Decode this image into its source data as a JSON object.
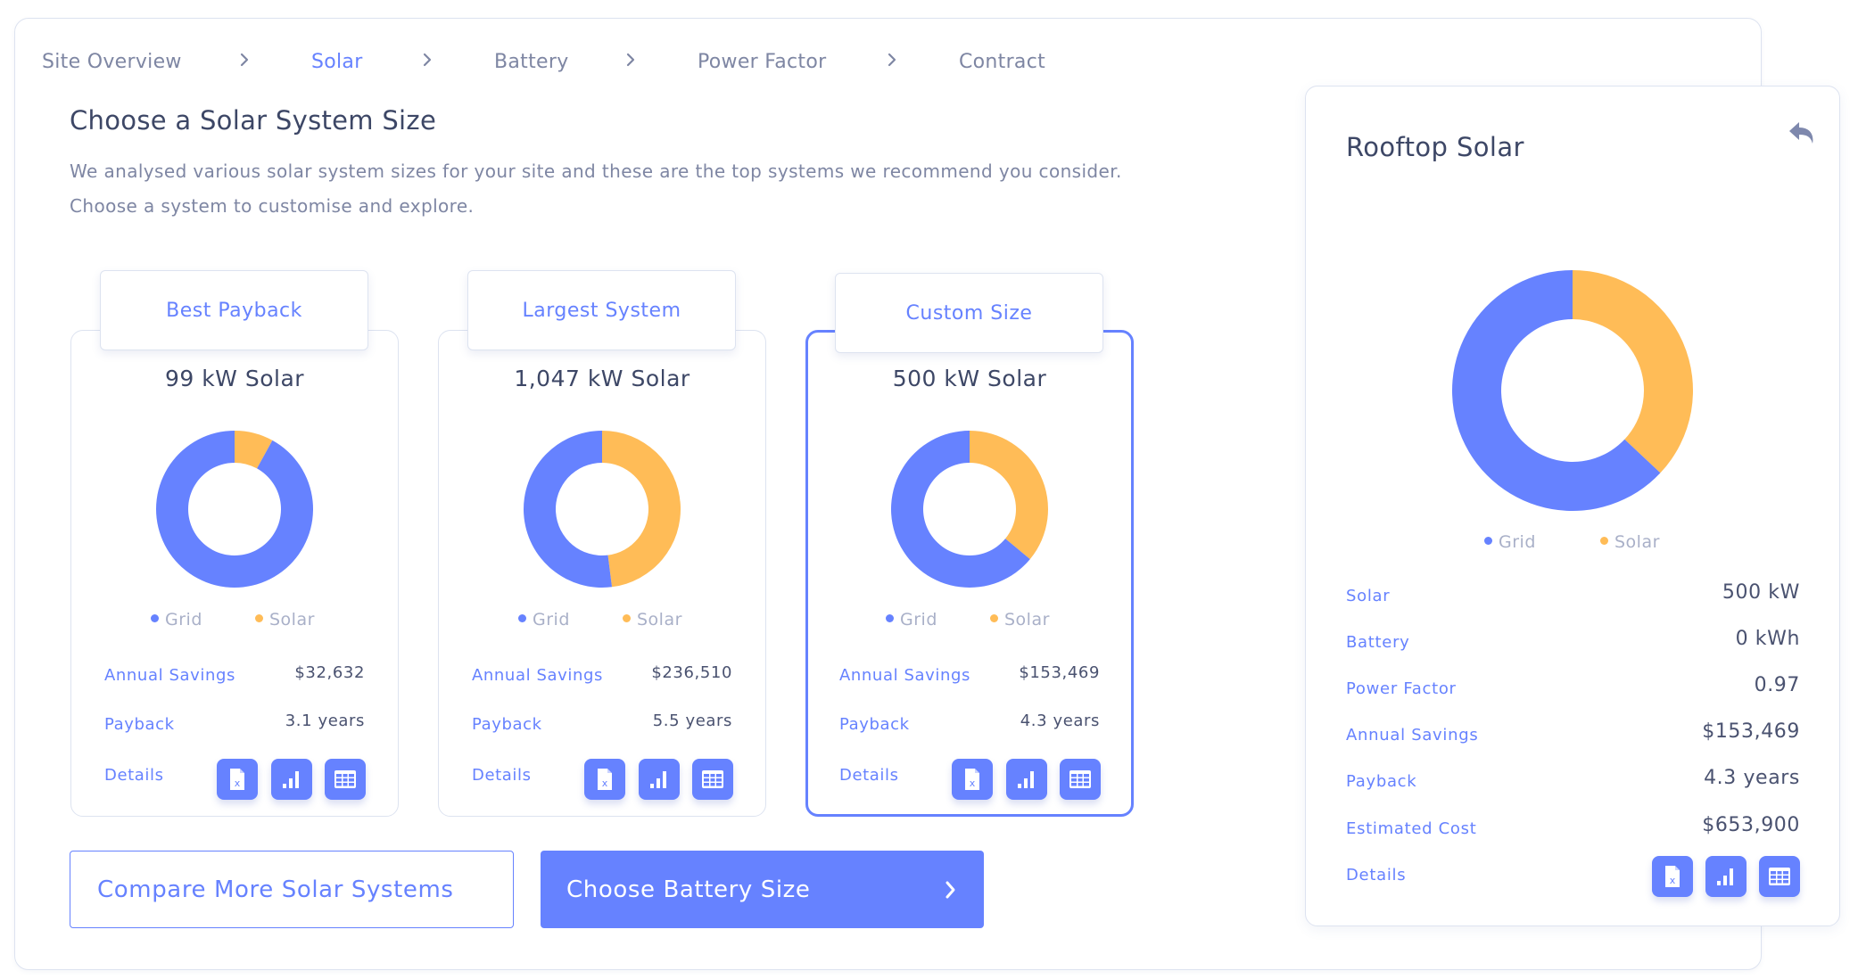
{
  "breadcrumb": {
    "items": [
      {
        "label": "Site Overview",
        "active": false
      },
      {
        "label": "Solar",
        "active": true
      },
      {
        "label": "Battery",
        "active": false
      },
      {
        "label": "Power Factor",
        "active": false
      },
      {
        "label": "Contract",
        "active": false
      }
    ],
    "separator_icon": "chevron-right-icon"
  },
  "header": {
    "title": "Choose a Solar System Size",
    "description_line1": "We analysed various solar system sizes for your site and these are the top systems we recommend you consider.",
    "description_line2": "Choose a system to customise and explore."
  },
  "colors": {
    "accent": "#6682ff",
    "grid": "#6682ff",
    "solar": "#ffbc57",
    "text_dark": "#3d4766",
    "text_muted": "#7e86a3",
    "border": "#dde3f0"
  },
  "legend": {
    "grid": "Grid",
    "solar": "Solar"
  },
  "cards": [
    {
      "tab_label": "Best Payback",
      "system_label": "99 kW Solar",
      "selected": false,
      "rows": {
        "annual_savings_label": "Annual Savings",
        "annual_savings": "$32,632",
        "payback_label": "Payback",
        "payback": "3.1 years",
        "details_label": "Details"
      }
    },
    {
      "tab_label": "Largest System",
      "system_label": "1,047 kW Solar",
      "selected": false,
      "rows": {
        "annual_savings_label": "Annual Savings",
        "annual_savings": "$236,510",
        "payback_label": "Payback",
        "payback": "5.5 years",
        "details_label": "Details"
      }
    },
    {
      "tab_label": "Custom Size",
      "system_label": "500 kW Solar",
      "selected": true,
      "rows": {
        "annual_savings_label": "Annual Savings",
        "annual_savings": "$153,469",
        "payback_label": "Payback",
        "payback": "4.3 years",
        "details_label": "Details"
      }
    }
  ],
  "detail_icons": [
    "excel-file-icon",
    "bar-chart-icon",
    "table-icon"
  ],
  "buttons": {
    "compare": "Compare More Solar Systems",
    "next": "Choose Battery Size"
  },
  "panel": {
    "title": "Rooftop Solar",
    "back_icon": "undo-icon",
    "rows": [
      {
        "label": "Solar",
        "value": "500 kW"
      },
      {
        "label": "Battery",
        "value": "0 kWh"
      },
      {
        "label": "Power Factor",
        "value": "0.97"
      },
      {
        "label": "Annual Savings",
        "value": "$153,469"
      },
      {
        "label": "Payback",
        "value": "4.3 years"
      },
      {
        "label": "Estimated Cost",
        "value": "$653,900"
      },
      {
        "label": "Details",
        "value": ""
      }
    ]
  },
  "chart_data": [
    {
      "type": "pie",
      "title": "99 kW Solar",
      "categories": [
        "Grid",
        "Solar"
      ],
      "values": [
        92,
        8
      ],
      "unit": "% of energy (est.)",
      "donut": true
    },
    {
      "type": "pie",
      "title": "1,047 kW Solar",
      "categories": [
        "Grid",
        "Solar"
      ],
      "values": [
        52,
        48
      ],
      "unit": "% of energy (est.)",
      "donut": true
    },
    {
      "type": "pie",
      "title": "500 kW Solar",
      "categories": [
        "Grid",
        "Solar"
      ],
      "values": [
        64,
        36
      ],
      "unit": "% of energy (est.)",
      "donut": true
    },
    {
      "type": "pie",
      "title": "Rooftop Solar",
      "categories": [
        "Grid",
        "Solar"
      ],
      "values": [
        63,
        37
      ],
      "unit": "% of energy (est.)",
      "donut": true
    }
  ]
}
